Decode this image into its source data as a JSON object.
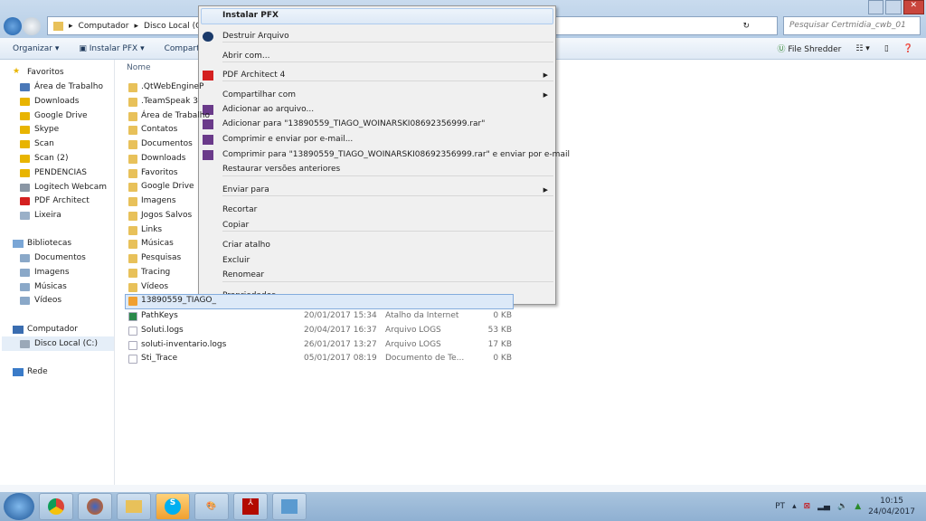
{
  "address": {
    "crumbs": [
      "Computador",
      "Disco Local (C:)"
    ],
    "search_placeholder": "Pesquisar Certmidia_cwb_01"
  },
  "toolbar": {
    "organize": "Organizar",
    "install_pfx": "Instalar PFX",
    "share": "Comparti",
    "file_shredder": "File Shredder"
  },
  "sidebar": {
    "favorites": {
      "label": "Favoritos",
      "items": [
        "Área de Trabalho",
        "Downloads",
        "Google Drive",
        "Skype",
        "Scan",
        "Scan (2)",
        "PENDENCIAS",
        "Logitech Webcam",
        "PDF Architect",
        "Lixeira"
      ]
    },
    "libraries": {
      "label": "Bibliotecas",
      "items": [
        "Documentos",
        "Imagens",
        "Músicas",
        "Vídeos"
      ]
    },
    "computer": {
      "label": "Computador",
      "items": [
        "Disco Local (C:)"
      ]
    },
    "network": {
      "label": "Rede"
    }
  },
  "files": {
    "column_name": "Nome",
    "folders": [
      ".QtWebEngineP",
      ".TeamSpeak 3",
      "Área de Trabalho",
      "Contatos",
      "Documentos",
      "Downloads",
      "Favoritos",
      "Google Drive",
      "Imagens",
      "Jogos Salvos",
      "Links",
      "Músicas",
      "Pesquisas",
      "Tracing",
      "Vídeos"
    ],
    "selected": "13890559_TIAGO_",
    "rows": [
      {
        "name": "PathKeys",
        "date": "20/01/2017 15:34",
        "type": "Atalho da Internet",
        "size": "0 KB"
      },
      {
        "name": "Soluti.logs",
        "date": "20/04/2017 16:37",
        "type": "Arquivo LOGS",
        "size": "53 KB"
      },
      {
        "name": "soluti-inventario.logs",
        "date": "26/01/2017 13:27",
        "type": "Arquivo LOGS",
        "size": "17 KB"
      },
      {
        "name": "Sti_Trace",
        "date": "05/01/2017 08:19",
        "type": "Documento de Te...",
        "size": "0 KB"
      }
    ]
  },
  "menu": {
    "items": [
      "Instalar PFX",
      "Destruir Arquivo",
      "Abrir com...",
      "PDF Architect 4",
      "Compartilhar com",
      "Adicionar ao arquivo...",
      "Adicionar para \"13890559_TIAGO_WOINARSKI08692356999.rar\"",
      "Comprimir e enviar por e-mail...",
      "Comprimir para \"13890559_TIAGO_WOINARSKI08692356999.rar\" e enviar por e-mail",
      "Restaurar versões anteriores",
      "Enviar para",
      "Recortar",
      "Copiar",
      "Criar atalho",
      "Excluir",
      "Renomear",
      "Propriedades"
    ]
  },
  "tray": {
    "lang": "PT",
    "time": "10:15",
    "date": "24/04/2017"
  }
}
